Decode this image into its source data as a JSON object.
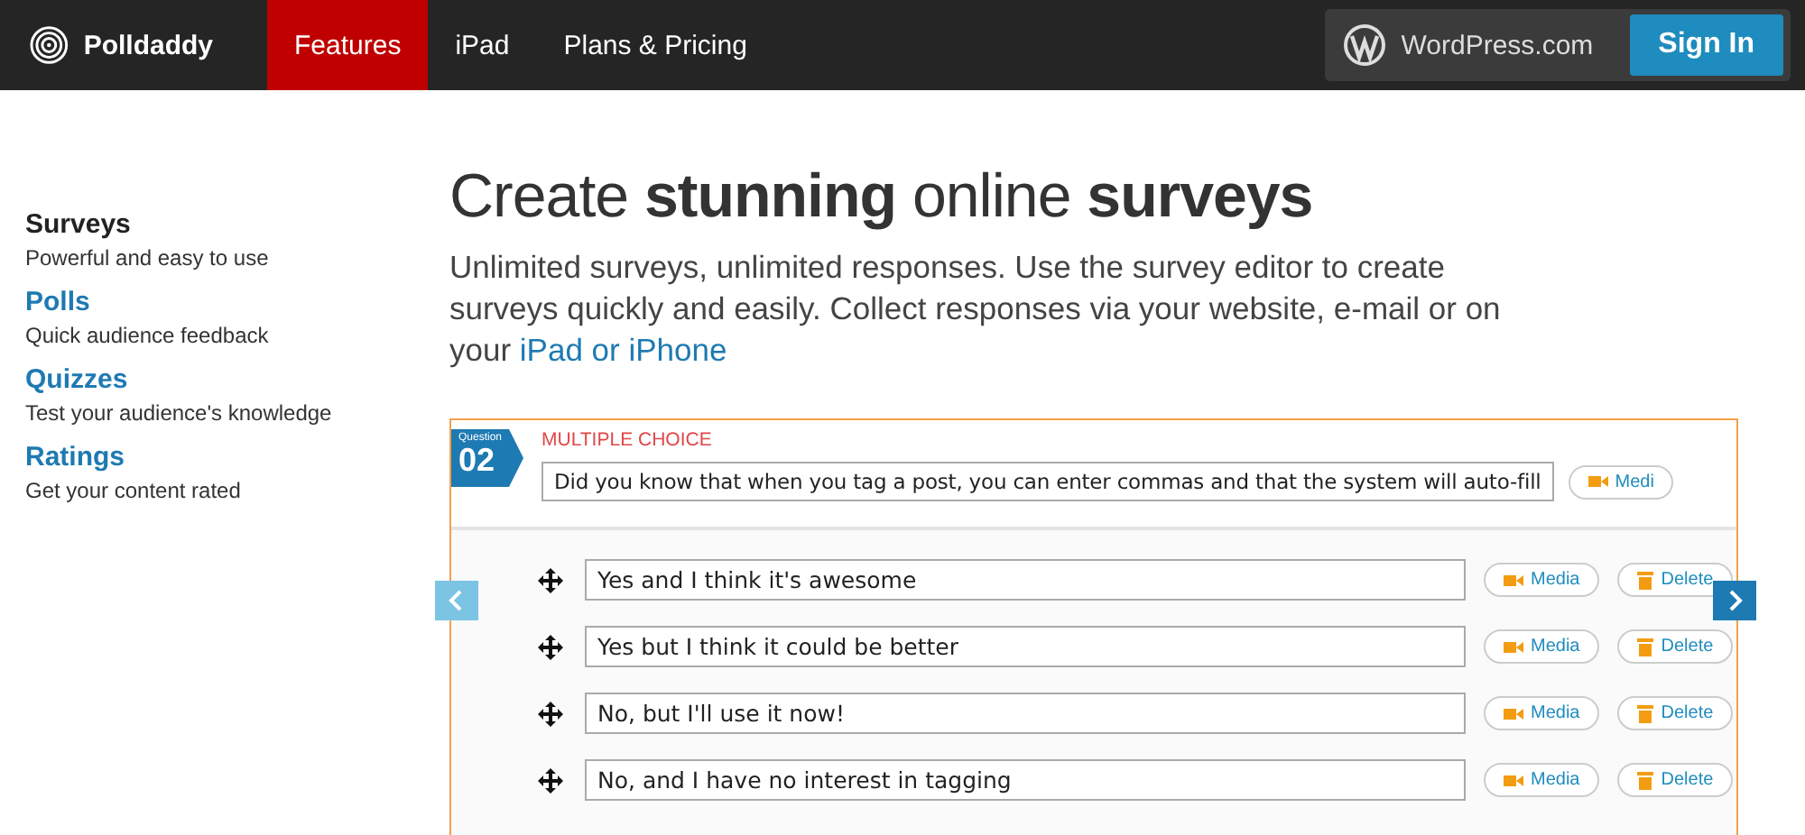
{
  "nav": {
    "brand": "Polldaddy",
    "tabs": [
      {
        "label": "Features",
        "selected": true
      },
      {
        "label": "iPad",
        "selected": false
      },
      {
        "label": "Plans & Pricing",
        "selected": false
      }
    ],
    "wordpress": "WordPress.com",
    "sign_in": "Sign In"
  },
  "sidebar": {
    "items": [
      {
        "title": "Surveys",
        "subtitle": "Powerful and easy to use",
        "selected": true
      },
      {
        "title": "Polls",
        "subtitle": "Quick audience feedback",
        "selected": false
      },
      {
        "title": "Quizzes",
        "subtitle": "Test your audience's knowledge",
        "selected": false
      },
      {
        "title": "Ratings",
        "subtitle": "Get your content rated",
        "selected": false
      }
    ]
  },
  "hero": {
    "title": "Create **stunning** online **surveys**",
    "description": "Unlimited surveys, unlimited responses. Use the survey editor to create surveys quickly and easily. Collect responses via your website, e-mail or on your",
    "link": "iPad or iPhone"
  },
  "editor": {
    "question_label": "Question",
    "question_number": "02",
    "question_type": "MULTIPLE CHOICE",
    "question_text": "Did you know that when you tag a post, you can enter commas and that the system will auto-fill",
    "question_media": "Medi",
    "answers": [
      {
        "text": "Yes and I think it's awesome",
        "media": "Media",
        "delete": "Delete"
      },
      {
        "text": "Yes but I think it could be better",
        "media": "Media",
        "delete": "Delete"
      },
      {
        "text": "No, but I'll use it now!",
        "media": "Media",
        "delete": "Delete"
      },
      {
        "text": "No, and I have no interest in tagging",
        "media": "Media",
        "delete": "Delete"
      }
    ]
  }
}
